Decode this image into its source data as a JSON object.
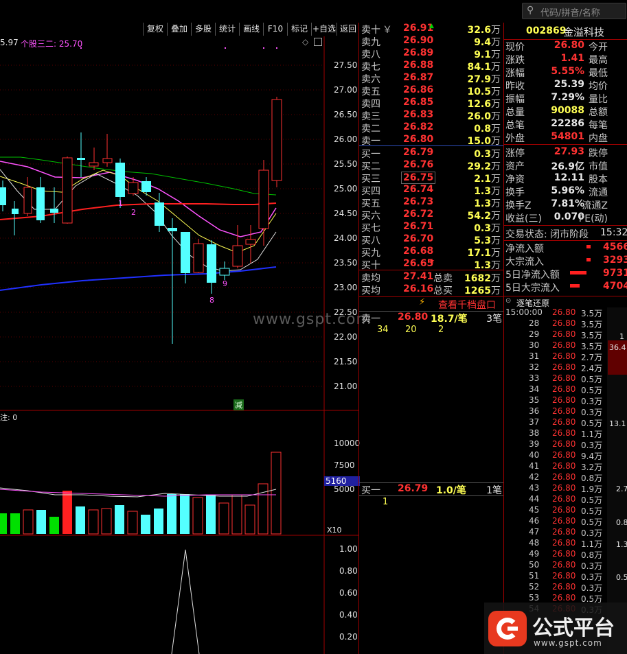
{
  "search": {
    "placeholder": "代码/拼音/名称"
  },
  "toolbar": {
    "items": [
      "复权",
      "叠加",
      "多股",
      "统计",
      "画线",
      "F10",
      "标记",
      "+自选",
      "返回"
    ]
  },
  "chart": {
    "header_left": "5.97",
    "header_ind": "个股三二: 25.70",
    "price_ticks": [
      "27.50",
      "27.00",
      "26.50",
      "26.00",
      "25.50",
      "25.00",
      "24.50",
      "24.00",
      "23.50",
      "23.00",
      "22.50",
      "22.00",
      "21.50",
      "21.00"
    ],
    "volume_ticks": [
      "10000",
      "7500",
      "5160",
      "5000"
    ],
    "volume_mult": "X10",
    "osc_ticks": [
      "1.00",
      "0.80",
      "0.60",
      "0.40",
      "0.20"
    ],
    "indicator_label": "注: 0",
    "marker_jian": "减",
    "marker_1": "1",
    "marker_2": "2",
    "marker_8": "8",
    "marker_9": "9",
    "watermark": "www.gspt.com"
  },
  "book": {
    "sell": [
      {
        "label": "卖十",
        "sym": "￥",
        "price": "26.91",
        "vol": "32.6",
        "unit": "万"
      },
      {
        "label": "卖九",
        "price": "26.90",
        "vol": "9.4",
        "unit": "万"
      },
      {
        "label": "卖八",
        "price": "26.89",
        "vol": "9.1",
        "unit": "万"
      },
      {
        "label": "卖七",
        "price": "26.88",
        "vol": "84.1",
        "unit": "万"
      },
      {
        "label": "卖六",
        "price": "26.87",
        "vol": "27.9",
        "unit": "万"
      },
      {
        "label": "卖五",
        "price": "26.86",
        "vol": "10.5",
        "unit": "万"
      },
      {
        "label": "卖四",
        "price": "26.85",
        "vol": "12.6",
        "unit": "万"
      },
      {
        "label": "卖三",
        "price": "26.83",
        "vol": "26.0",
        "unit": "万"
      },
      {
        "label": "卖二",
        "price": "26.82",
        "vol": "0.8",
        "unit": "万"
      },
      {
        "label": "卖一",
        "price": "26.80",
        "vol": "15.0",
        "unit": "万"
      }
    ],
    "buy": [
      {
        "label": "买一",
        "price": "26.79",
        "vol": "0.3",
        "unit": "万"
      },
      {
        "label": "买二",
        "price": "26.76",
        "vol": "29.2",
        "unit": "万"
      },
      {
        "label": "买三",
        "price": "26.75",
        "vol": "2.1",
        "unit": "万"
      },
      {
        "label": "买四",
        "price": "26.74",
        "vol": "1.3",
        "unit": "万"
      },
      {
        "label": "买五",
        "price": "26.73",
        "vol": "1.3",
        "unit": "万"
      },
      {
        "label": "买六",
        "price": "26.72",
        "vol": "54.2",
        "unit": "万"
      },
      {
        "label": "买七",
        "price": "26.71",
        "vol": "0.3",
        "unit": "万"
      },
      {
        "label": "买八",
        "price": "26.70",
        "vol": "5.3",
        "unit": "万"
      },
      {
        "label": "买九",
        "price": "26.68",
        "vol": "17.1",
        "unit": "万"
      },
      {
        "label": "买十",
        "price": "26.65",
        "vol": "1.3",
        "unit": "万"
      }
    ],
    "avg_sell_label": "卖均",
    "avg_sell": "27.41",
    "total_sell_label": "总卖",
    "total_sell": "1682",
    "total_sell_unit": "万",
    "avg_buy_label": "买均",
    "avg_buy": "26.16",
    "total_buy_label": "总买",
    "total_buy": "1265",
    "total_buy_unit": "万",
    "view_ten": "查看千档盘口",
    "sell1_label": "卖一",
    "sell1_price": "26.80",
    "sell1_vol": "18.7/笔",
    "sell1_count": "3笔",
    "sell1_queue": [
      "34",
      "20",
      "2"
    ],
    "buy1_label": "买一",
    "buy1_price": "26.79",
    "buy1_vol": "1.0/笔",
    "buy1_count": "1笔",
    "buy1_queue": [
      "1"
    ]
  },
  "stock": {
    "code": "002869",
    "name": "金溢科技"
  },
  "stats": [
    {
      "k1": "现价",
      "v1": "26.80",
      "c": "red",
      "k2": "今开"
    },
    {
      "k1": "涨跌",
      "v1": "1.41",
      "c": "red",
      "k2": "最高"
    },
    {
      "k1": "涨幅",
      "v1": "5.55%",
      "c": "red",
      "k2": "最低"
    },
    {
      "k1": "昨收",
      "v1": "25.39",
      "c": "wht",
      "k2": "均价"
    },
    {
      "k1": "振幅",
      "v1": "7.29%",
      "c": "wht",
      "k2": "量比"
    },
    {
      "k1": "总量",
      "v1": "90088",
      "c": "yel",
      "k2": "总额"
    },
    {
      "k1": "总笔",
      "v1": "22286",
      "c": "wht",
      "k2": "每笔"
    },
    {
      "k1": "外盘",
      "v1": "54801",
      "c": "red",
      "k2": "内盘"
    },
    {
      "k1": "涨停",
      "v1": "27.93",
      "c": "red",
      "k2": "跌停"
    },
    {
      "k1": "资产",
      "v1": "26.9亿",
      "c": "wht",
      "k2": "市值"
    },
    {
      "k1": "净资",
      "v1": "12.11",
      "c": "wht",
      "k2": "股本"
    },
    {
      "k1": "换手",
      "v1": "5.96%",
      "c": "wht",
      "k2": "流通"
    },
    {
      "k1": "换手Z",
      "v1": "7.81%",
      "c": "wht",
      "k2": "流通Z"
    },
    {
      "k1": "收益(三)",
      "v1": "0.070",
      "c": "wht",
      "k2": "PE(动)"
    }
  ],
  "trade_state": {
    "label": "交易状态: 闭市阶段",
    "time": "15:32"
  },
  "flows": [
    {
      "label": "净流入额",
      "value": "4566"
    },
    {
      "label": "大宗流入",
      "value": "3293"
    },
    {
      "label": "5日净流入额",
      "value": "9731"
    },
    {
      "label": "5日大宗流入",
      "value": "4704"
    }
  ],
  "ticks": {
    "title": "逐笔还原",
    "rows": [
      {
        "t": "15:00:00",
        "p": "26.80",
        "v": "3.5万"
      },
      {
        "t": "28",
        "p": "26.80",
        "v": "3.5万"
      },
      {
        "t": "29",
        "p": "26.80",
        "v": "3.5万"
      },
      {
        "t": "30",
        "p": "26.80",
        "v": "3.5万"
      },
      {
        "t": "31",
        "p": "26.80",
        "v": "2.7万"
      },
      {
        "t": "32",
        "p": "26.80",
        "v": "2.4万"
      },
      {
        "t": "33",
        "p": "26.80",
        "v": "0.5万"
      },
      {
        "t": "34",
        "p": "26.80",
        "v": "0.5万"
      },
      {
        "t": "35",
        "p": "26.80",
        "v": "0.3万"
      },
      {
        "t": "36",
        "p": "26.80",
        "v": "0.3万"
      },
      {
        "t": "37",
        "p": "26.80",
        "v": "0.5万"
      },
      {
        "t": "38",
        "p": "26.80",
        "v": "1.1万"
      },
      {
        "t": "39",
        "p": "26.80",
        "v": "0.3万"
      },
      {
        "t": "40",
        "p": "26.80",
        "v": "9.4万"
      },
      {
        "t": "41",
        "p": "26.80",
        "v": "3.2万"
      },
      {
        "t": "42",
        "p": "26.80",
        "v": "0.8万"
      },
      {
        "t": "43",
        "p": "26.80",
        "v": "1.9万"
      },
      {
        "t": "44",
        "p": "26.80",
        "v": "0.5万"
      },
      {
        "t": "45",
        "p": "26.80",
        "v": "0.5万"
      },
      {
        "t": "46",
        "p": "26.80",
        "v": "0.5万"
      },
      {
        "t": "47",
        "p": "26.80",
        "v": "0.3万"
      },
      {
        "t": "48",
        "p": "26.80",
        "v": "1.1万"
      },
      {
        "t": "49",
        "p": "26.80",
        "v": "0.8万"
      },
      {
        "t": "50",
        "p": "26.80",
        "v": "0.3万"
      },
      {
        "t": "51",
        "p": "26.80",
        "v": "0.3万"
      },
      {
        "t": "52",
        "p": "26.80",
        "v": "0.3万"
      },
      {
        "t": "53",
        "p": "26.80",
        "v": "0.5万"
      },
      {
        "t": "54",
        "p": "26.80",
        "v": "0.3万"
      }
    ],
    "side_vals": [
      "1",
      "36.4",
      "13.1",
      "2.7",
      "0.8",
      "1.3",
      "0.5"
    ]
  },
  "logo": {
    "title": "公式平台",
    "url": "www.gspt.com"
  }
}
